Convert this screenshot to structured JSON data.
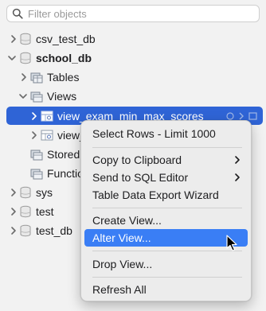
{
  "search": {
    "placeholder": "Filter objects",
    "value": ""
  },
  "tree": {
    "csv_test_db": "csv_test_db",
    "school_db": "school_db",
    "tables": "Tables",
    "views": "Views",
    "view1": "view_exam_min_max_scores",
    "view2": "view_",
    "stored": "Stored",
    "functions": "Functio",
    "sys": "sys",
    "test": "test",
    "test_db": "test_db"
  },
  "menu": {
    "select_rows": "Select Rows - Limit 1000",
    "copy_clipboard": "Copy to Clipboard",
    "send_sql": "Send to SQL Editor",
    "export_wizard": "Table Data Export Wizard",
    "create_view": "Create View...",
    "alter_view": "Alter View...",
    "drop_view": "Drop View...",
    "refresh_all": "Refresh All"
  },
  "colors": {
    "selection": "#2f64d6",
    "menu_highlight": "#3a7ef5",
    "background": "#f2f2f2"
  },
  "icons": {
    "search": "magnifier-icon",
    "database": "database-icon",
    "folder": "folder-icon",
    "view": "view-icon",
    "chevron": "chevron-icon"
  }
}
